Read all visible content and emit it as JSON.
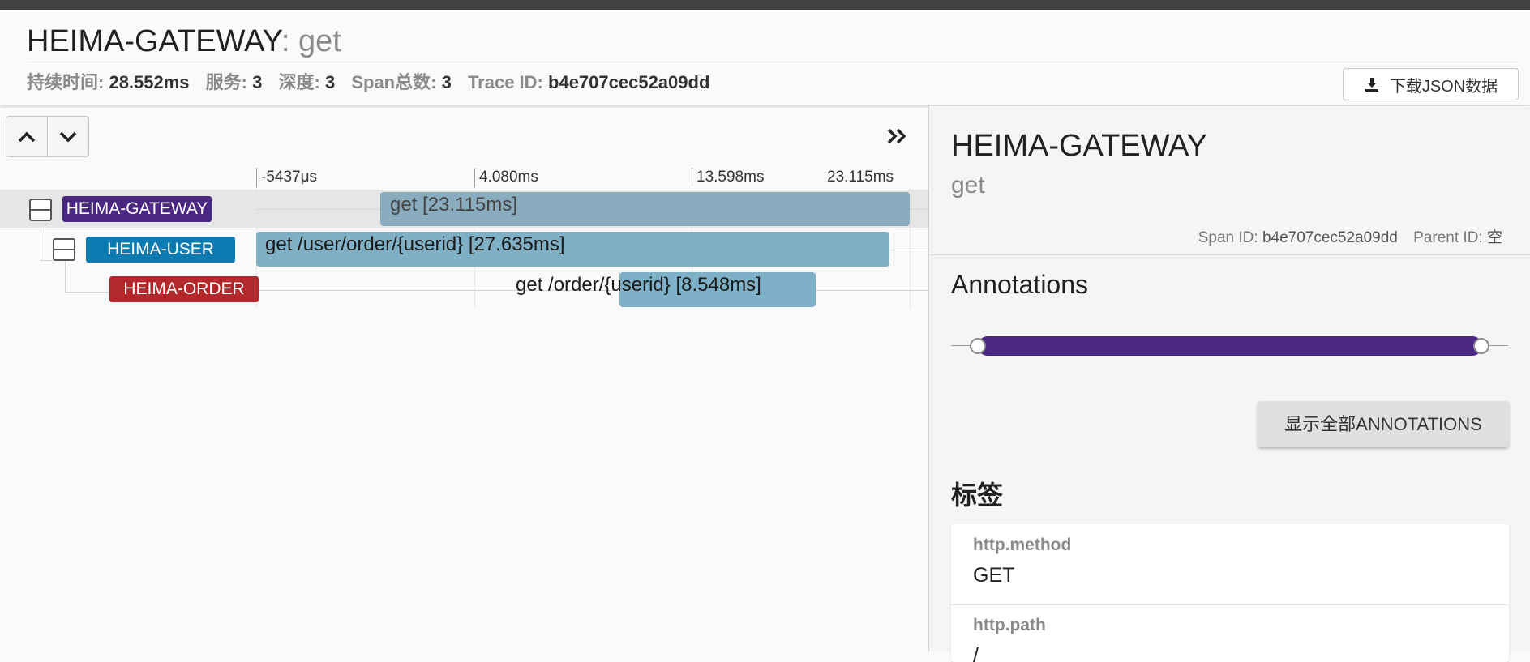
{
  "header": {
    "service": "HEIMA-GATEWAY",
    "separator": ":",
    "operation": "get",
    "stats": [
      {
        "label": "持续时间:",
        "value": "28.552ms"
      },
      {
        "label": "服务:",
        "value": "3"
      },
      {
        "label": "深度:",
        "value": "3"
      },
      {
        "label": "Span总数:",
        "value": "3"
      },
      {
        "label": "Trace ID:",
        "value": "b4e707cec52a09dd"
      }
    ],
    "download_label": "下载JSON数据"
  },
  "timeline": {
    "ticks": [
      "-5437μs",
      "4.080ms",
      "13.598ms",
      "23.115ms"
    ],
    "spans": [
      {
        "service": "HEIMA-GATEWAY",
        "color": "#4a2783",
        "label": "get [23.115ms]"
      },
      {
        "service": "HEIMA-USER",
        "color": "#0b7bb2",
        "label": "get /user/order/{userid} [27.635ms]"
      },
      {
        "service": "HEIMA-ORDER",
        "color": "#b3282a",
        "label": "get /order/{userid} [8.548ms]"
      }
    ]
  },
  "detail": {
    "service": "HEIMA-GATEWAY",
    "operation": "get",
    "span_id_label": "Span ID:",
    "span_id": "b4e707cec52a09dd",
    "parent_id_label": "Parent ID:",
    "parent_id": "空",
    "annotations_title": "Annotations",
    "show_all_label": "显示全部ANNOTATIONS",
    "tags_title": "标签",
    "tags": [
      {
        "key": "http.method",
        "value": "GET"
      },
      {
        "key": "http.path",
        "value": "/"
      }
    ]
  },
  "colors": {
    "gateway": "#4a2783",
    "user": "#0b7bb2",
    "order": "#b3282a",
    "bar": "#89acbf"
  }
}
